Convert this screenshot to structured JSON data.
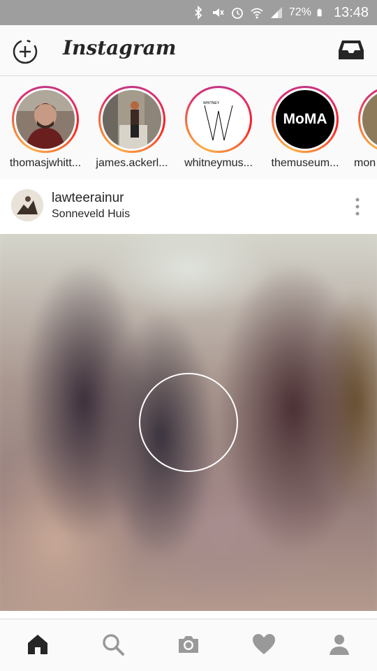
{
  "status_bar": {
    "battery": "72%",
    "time": "13:48"
  },
  "header": {
    "title": "Instagram"
  },
  "stories": [
    {
      "name": "thomasjwhitt...",
      "avatar": "portrait"
    },
    {
      "name": "james.ackerl...",
      "avatar": "room-photo"
    },
    {
      "name": "whitneymus...",
      "avatar": "whitney-logo",
      "logo_text": "WHITNEY"
    },
    {
      "name": "themuseum...",
      "avatar": "moma-logo",
      "logo_text": "MoMA"
    },
    {
      "name": "mon",
      "avatar": "partial"
    }
  ],
  "post": {
    "username": "lawteerainur",
    "location": "Sonneveld Huis"
  },
  "tabs": [
    "home-icon",
    "search-icon",
    "camera-icon",
    "heart-icon",
    "profile-icon"
  ],
  "colors": {
    "status_bar": "#9e9e9e",
    "ring_start": "#c13584",
    "ring_end": "#fcaf45",
    "text": "#262626"
  }
}
